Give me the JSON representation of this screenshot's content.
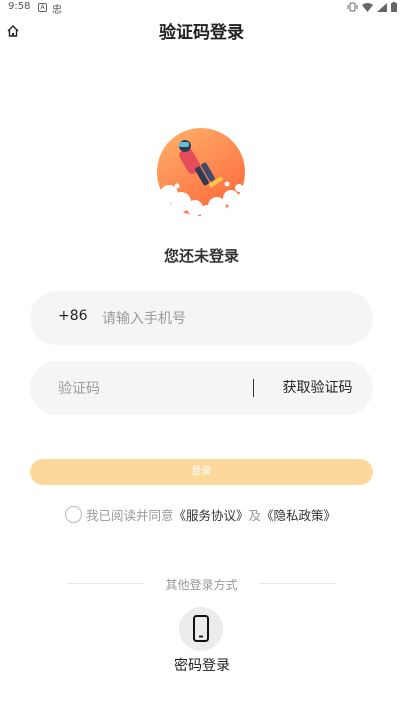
{
  "status_bar": {
    "time": "9:58",
    "indicator_a": "A",
    "indicator_b": "忠"
  },
  "header": {
    "title": "验证码登录"
  },
  "hero": {
    "status_text": "您还未登录"
  },
  "form": {
    "country_code": "+86",
    "phone_placeholder": "请输入手机号",
    "code_placeholder": "验证码",
    "get_code_label": "获取验证码",
    "login_label": "登录"
  },
  "agreement": {
    "prefix": "我已阅读并同意",
    "service_link": "《服务协议》",
    "conjunction": "及",
    "privacy_link": "《隐私政策》",
    "checked": false
  },
  "other_login": {
    "heading": "其他登录方式",
    "password_login_label": "密码登录"
  },
  "colors": {
    "accent_orange": "#ff8a4c",
    "login_button_disabled": "#fdd89c",
    "field_background": "#f4f5f7"
  },
  "icons": {
    "home": "home-icon",
    "phone": "smartphone-icon",
    "wifi": "wifi-icon",
    "signal": "signal-icon",
    "battery": "battery-icon",
    "vibrate": "vibrate-icon"
  }
}
